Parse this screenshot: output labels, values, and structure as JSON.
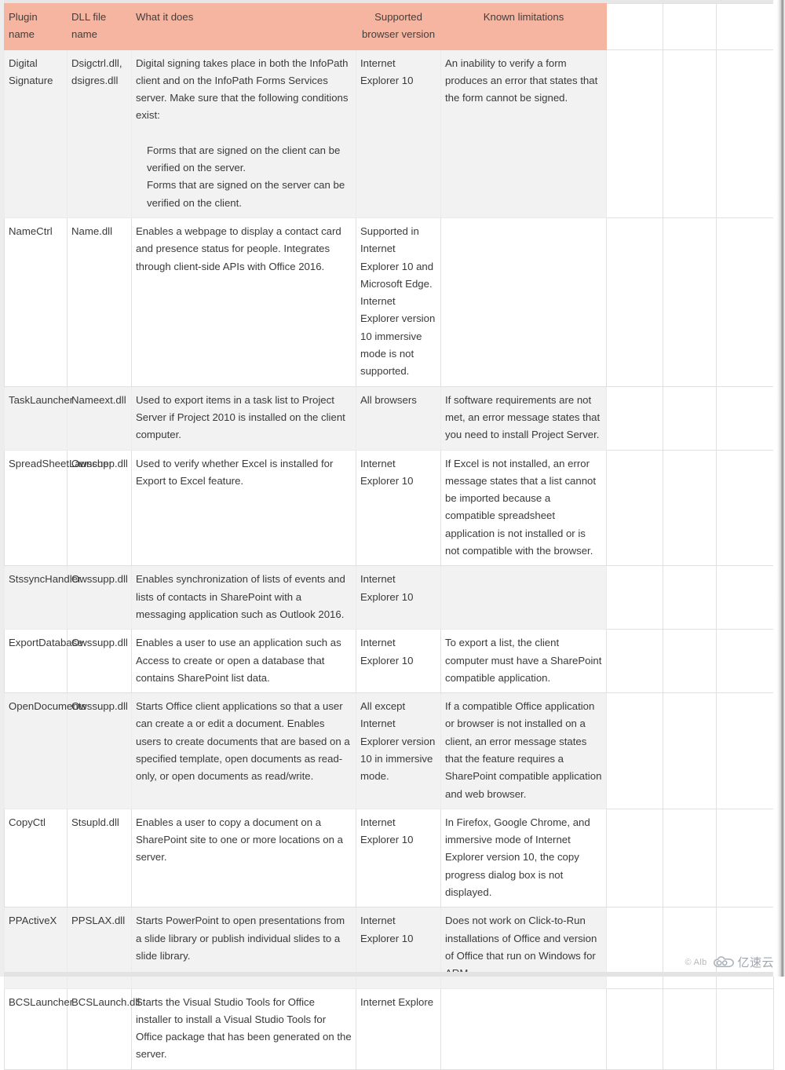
{
  "table": {
    "headers": [
      "Plugin name",
      "DLL file name",
      "What it does",
      "Supported browser version",
      "Known limitations",
      "",
      "",
      ""
    ],
    "rows": [
      {
        "plugin_name": "Digital Signature",
        "dll_file_name": "Dsigctrl.dll, dsigres.dll",
        "what_it_does": "Digital signing takes place in both the InfoPath client and on the InfoPath Forms Services server. Make sure that the following conditions exist:",
        "what_it_does_indent": [
          "Forms that are signed on the client can be verified on the server.",
          "Forms that are signed on the server can be verified on the client."
        ],
        "supported_browser_version": "Internet Explorer 10",
        "known_limitations": "An inability to verify a form produces an error that states that the form cannot be signed."
      },
      {
        "plugin_name": "NameCtrl",
        "dll_file_name": "Name.dll",
        "what_it_does": "Enables a webpage to display a contact card and presence status for people. Integrates through client-side APIs with Office 2016.",
        "what_it_does_indent": [],
        "supported_browser_version": "Supported in Internet Explorer 10 and Microsoft Edge.\nInternet Explorer version 10 immersive mode is not supported.",
        "known_limitations": ""
      },
      {
        "plugin_name": "TaskLauncher",
        "dll_file_name": "Nameext.dll",
        "what_it_does": "Used to export items in a task list to Project Server if Project 2010 is installed on the client computer.",
        "what_it_does_indent": [],
        "supported_browser_version": "All browsers",
        "known_limitations": "If software requirements are not met, an error message states that you need to install Project Server."
      },
      {
        "plugin_name": "SpreadSheetLauncher",
        "dll_file_name": "Owssupp.dll",
        "what_it_does": "Used to verify whether Excel is installed for Export to Excel feature.",
        "what_it_does_indent": [],
        "supported_browser_version": "Internet Explorer 10",
        "known_limitations": "If Excel is not installed, an error message states that a list cannot be imported because a compatible spreadsheet application is not installed or is not compatible with the browser."
      },
      {
        "plugin_name": "StssyncHandler",
        "dll_file_name": "Owssupp.dll",
        "what_it_does": "Enables synchronization of lists of events and lists of contacts in SharePoint with a messaging application such as Outlook 2016.",
        "what_it_does_indent": [],
        "supported_browser_version": "Internet Explorer 10",
        "known_limitations": ""
      },
      {
        "plugin_name": "ExportDatabase",
        "dll_file_name": "Owssupp.dll",
        "what_it_does": "Enables a user to use an application such as Access to create or open a database that contains SharePoint list data.",
        "what_it_does_indent": [],
        "supported_browser_version": "Internet Explorer 10",
        "known_limitations": "To export a list, the client computer must have a SharePoint compatible application."
      },
      {
        "plugin_name": "OpenDocuments",
        "dll_file_name": "Owssupp.dll",
        "what_it_does": "Starts Office client applications so that a user can create a or edit a document. Enables users to create documents that are based on a specified template, open documents as read-only, or open documents as read/write.",
        "what_it_does_indent": [],
        "supported_browser_version": "All except Internet Explorer version 10 in immersive mode.",
        "known_limitations": "If a compatible Office application or browser is not installed on a client, an error message states that the feature requires a SharePoint compatible application and web browser."
      },
      {
        "plugin_name": "CopyCtl",
        "dll_file_name": "Stsupld.dll",
        "what_it_does": "Enables a user to copy a document on a SharePoint site to one or more locations on a server.",
        "what_it_does_indent": [],
        "supported_browser_version": "Internet Explorer 10",
        "known_limitations": "In Firefox, Google Chrome, and immersive mode of Internet Explorer version 10, the copy progress dialog box is not displayed."
      },
      {
        "plugin_name": "PPActiveX",
        "dll_file_name": "PPSLAX.dll",
        "what_it_does": "Starts PowerPoint to open presentations from a slide library or publish individual slides to a slide library.",
        "what_it_does_indent": [],
        "supported_browser_version": "Internet Explorer 10",
        "known_limitations": "Does not work on Click-to-Run installations of Office and version of Office that run on Windows for ARM."
      },
      {
        "plugin_name": "BCSLauncher",
        "dll_file_name": "BCSLaunch.dll",
        "what_it_does": "Starts the Visual Studio Tools for Office installer to install a Visual Studio Tools for Office package that has been generated on the server.",
        "what_it_does_indent": [],
        "supported_browser_version": "Internet Explore",
        "known_limitations": ""
      }
    ]
  },
  "watermark": {
    "copyright": "© Alb",
    "brand": "亿速云"
  },
  "colors": {
    "header_background": "#f6b5a0",
    "row_shaded": "#f2f2f2",
    "row_plain": "#ffffff",
    "grid_line": "#e0e0e0",
    "text": "#3a3a3a"
  }
}
